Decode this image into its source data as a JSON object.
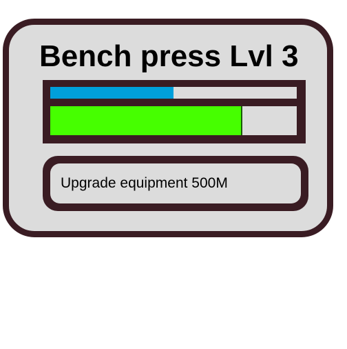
{
  "card": {
    "title": "Bench press Lvl 3",
    "progress": {
      "top_bar_fraction": 0.5,
      "bottom_bar_fraction": 0.78
    },
    "upgrade_button": {
      "label": "Upgrade equipment 500M"
    }
  },
  "colors": {
    "frame": "#3a1c23",
    "panel": "#dcdcdc",
    "top_bar": "#009fdb",
    "bottom_bar": "#46ff00"
  }
}
